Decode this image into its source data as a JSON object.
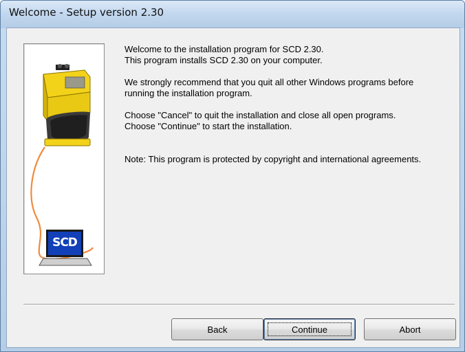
{
  "window": {
    "title": "Welcome - Setup version 2.30"
  },
  "illustration": {
    "screen_label": "SCD"
  },
  "content": {
    "line1": "Welcome to the installation program for SCD 2.30.",
    "line2": "This program installs SCD 2.30 on your computer.",
    "line3": "We strongly recommend that you quit all other Windows programs before",
    "line4": "running the installation program.",
    "line5": "Choose \"Cancel\" to quit the installation and close all open programs.",
    "line6": "Choose \"Continue\" to start the installation.",
    "line7": "Note: This program is protected by copyright and international agreements."
  },
  "buttons": {
    "back": "Back",
    "continue": "Continue",
    "abort": "Abort"
  },
  "colors": {
    "device_yellow": "#f3d21a",
    "cable_orange": "#f08a3c",
    "screen_blue": "#1240b8"
  }
}
